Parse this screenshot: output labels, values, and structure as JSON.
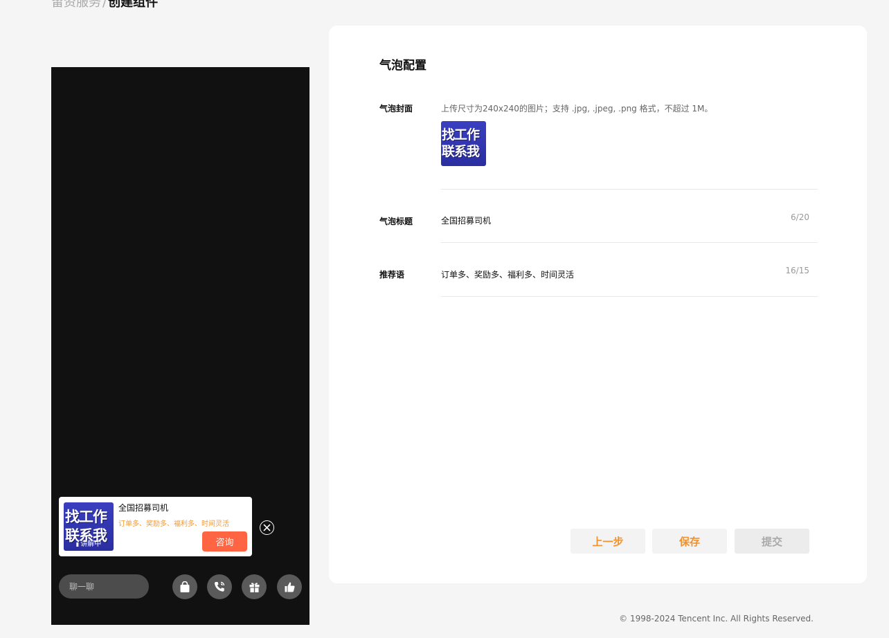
{
  "breadcrumb": {
    "parent": "留资服务",
    "separator": "/",
    "current": "创建组件"
  },
  "preview": {
    "cover_text": [
      "找工作",
      "联系我"
    ],
    "live_tag": "讲解中",
    "bubble_title": "全国招募司机",
    "bubble_subtitle": "订单多、奖励多、福利多、时间灵活",
    "consult_label": "咨询",
    "chat_placeholder": "聊一聊",
    "actions": [
      "shopping-bag-icon",
      "phone-call-icon",
      "gift-icon",
      "thumbs-up-icon"
    ]
  },
  "config": {
    "title": "气泡配置",
    "cover": {
      "label": "气泡封面",
      "hint": "上传尺寸为240x240的图片；支持 .jpg, .jpeg, .png 格式，不超过 1M。",
      "image_text": [
        "找工作",
        "联系我"
      ]
    },
    "bubble_title": {
      "label": "气泡标题",
      "value": "全国招募司机",
      "counter": "6/20"
    },
    "recommendation": {
      "label": "推荐语",
      "value": "订单多、奖励多、福利多、时间灵活",
      "counter": "16/15"
    }
  },
  "buttons": {
    "prev": "上一步",
    "save": "保存",
    "submit": "提交"
  },
  "footer": {
    "copyright": "© 1998-2024 Tencent Inc. All Rights Reserved."
  },
  "colors": {
    "accent": "#f0922e",
    "consult": "#ff6443",
    "subtitle": "#f19a3a",
    "cover": "#3a3fc0"
  }
}
